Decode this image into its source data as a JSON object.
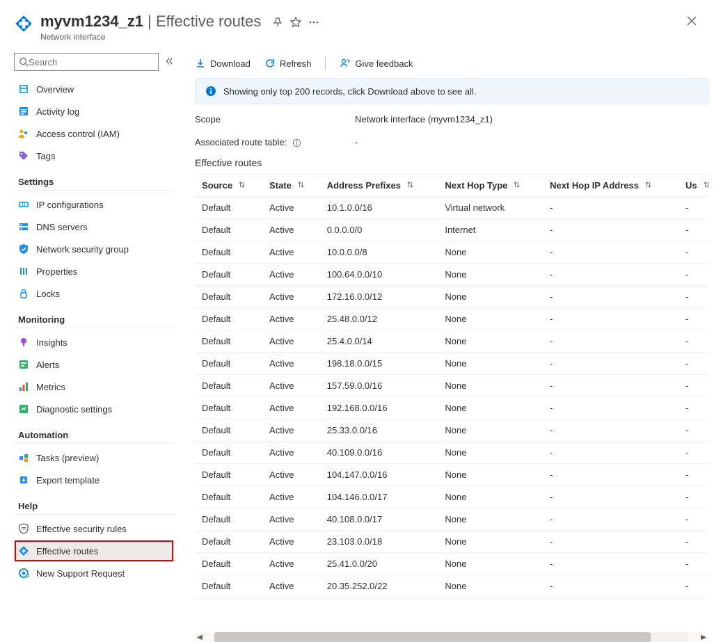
{
  "header": {
    "resource_name": "myvm1234_z1",
    "page_title": "Effective routes",
    "subtitle": "Network interface"
  },
  "search": {
    "placeholder": "Search"
  },
  "sidebar": {
    "top_items": [
      {
        "label": "Overview",
        "icon": "overview",
        "name": "overview"
      },
      {
        "label": "Activity log",
        "icon": "activity",
        "name": "activity-log"
      },
      {
        "label": "Access control (IAM)",
        "icon": "iam",
        "name": "access-control"
      },
      {
        "label": "Tags",
        "icon": "tags",
        "name": "tags"
      }
    ],
    "groups": [
      {
        "title": "Settings",
        "items": [
          {
            "label": "IP configurations",
            "icon": "ipconfig",
            "name": "ip-configurations"
          },
          {
            "label": "DNS servers",
            "icon": "dns",
            "name": "dns-servers"
          },
          {
            "label": "Network security group",
            "icon": "nsg",
            "name": "network-security-group"
          },
          {
            "label": "Properties",
            "icon": "properties",
            "name": "properties"
          },
          {
            "label": "Locks",
            "icon": "locks",
            "name": "locks"
          }
        ]
      },
      {
        "title": "Monitoring",
        "items": [
          {
            "label": "Insights",
            "icon": "insights",
            "name": "insights"
          },
          {
            "label": "Alerts",
            "icon": "alerts",
            "name": "alerts"
          },
          {
            "label": "Metrics",
            "icon": "metrics",
            "name": "metrics"
          },
          {
            "label": "Diagnostic settings",
            "icon": "diag",
            "name": "diagnostic-settings"
          }
        ]
      },
      {
        "title": "Automation",
        "items": [
          {
            "label": "Tasks (preview)",
            "icon": "tasks",
            "name": "tasks"
          },
          {
            "label": "Export template",
            "icon": "export",
            "name": "export-template"
          }
        ]
      },
      {
        "title": "Help",
        "items": [
          {
            "label": "Effective security rules",
            "icon": "effsec",
            "name": "effective-security-rules"
          },
          {
            "label": "Effective routes",
            "icon": "effroutes",
            "name": "effective-routes",
            "selected": true,
            "highlighted": true
          },
          {
            "label": "New Support Request",
            "icon": "support",
            "name": "new-support-request"
          }
        ]
      }
    ]
  },
  "toolbar": {
    "download": "Download",
    "refresh": "Refresh",
    "feedback": "Give feedback"
  },
  "info_bar": "Showing only top 200 records, click Download above to see all.",
  "scope": {
    "label": "Scope",
    "value": "Network interface (myvm1234_z1)"
  },
  "associated": {
    "label": "Associated route table:",
    "value": "-"
  },
  "section_title": "Effective routes",
  "table": {
    "columns": [
      {
        "label": "Source",
        "name": "source"
      },
      {
        "label": "State",
        "name": "state"
      },
      {
        "label": "Address Prefixes",
        "name": "address-prefixes"
      },
      {
        "label": "Next Hop Type",
        "name": "next-hop-type"
      },
      {
        "label": "Next Hop IP Address",
        "name": "next-hop-ip"
      },
      {
        "label": "Us",
        "name": "user-defined-partial"
      }
    ],
    "rows": [
      {
        "source": "Default",
        "state": "Active",
        "prefix": "10.1.0.0/16",
        "nexthop": "Virtual network",
        "ip": "-",
        "us": "-"
      },
      {
        "source": "Default",
        "state": "Active",
        "prefix": "0.0.0.0/0",
        "nexthop": "Internet",
        "ip": "-",
        "us": "-"
      },
      {
        "source": "Default",
        "state": "Active",
        "prefix": "10.0.0.0/8",
        "nexthop": "None",
        "ip": "-",
        "us": "-"
      },
      {
        "source": "Default",
        "state": "Active",
        "prefix": "100.64.0.0/10",
        "nexthop": "None",
        "ip": "-",
        "us": "-"
      },
      {
        "source": "Default",
        "state": "Active",
        "prefix": "172.16.0.0/12",
        "nexthop": "None",
        "ip": "-",
        "us": "-"
      },
      {
        "source": "Default",
        "state": "Active",
        "prefix": "25.48.0.0/12",
        "nexthop": "None",
        "ip": "-",
        "us": "-"
      },
      {
        "source": "Default",
        "state": "Active",
        "prefix": "25.4.0.0/14",
        "nexthop": "None",
        "ip": "-",
        "us": "-"
      },
      {
        "source": "Default",
        "state": "Active",
        "prefix": "198.18.0.0/15",
        "nexthop": "None",
        "ip": "-",
        "us": "-"
      },
      {
        "source": "Default",
        "state": "Active",
        "prefix": "157.59.0.0/16",
        "nexthop": "None",
        "ip": "-",
        "us": "-"
      },
      {
        "source": "Default",
        "state": "Active",
        "prefix": "192.168.0.0/16",
        "nexthop": "None",
        "ip": "-",
        "us": "-"
      },
      {
        "source": "Default",
        "state": "Active",
        "prefix": "25.33.0.0/16",
        "nexthop": "None",
        "ip": "-",
        "us": "-"
      },
      {
        "source": "Default",
        "state": "Active",
        "prefix": "40.109.0.0/16",
        "nexthop": "None",
        "ip": "-",
        "us": "-"
      },
      {
        "source": "Default",
        "state": "Active",
        "prefix": "104.147.0.0/16",
        "nexthop": "None",
        "ip": "-",
        "us": "-"
      },
      {
        "source": "Default",
        "state": "Active",
        "prefix": "104.146.0.0/17",
        "nexthop": "None",
        "ip": "-",
        "us": "-"
      },
      {
        "source": "Default",
        "state": "Active",
        "prefix": "40.108.0.0/17",
        "nexthop": "None",
        "ip": "-",
        "us": "-"
      },
      {
        "source": "Default",
        "state": "Active",
        "prefix": "23.103.0.0/18",
        "nexthop": "None",
        "ip": "-",
        "us": "-"
      },
      {
        "source": "Default",
        "state": "Active",
        "prefix": "25.41.0.0/20",
        "nexthop": "None",
        "ip": "-",
        "us": "-"
      },
      {
        "source": "Default",
        "state": "Active",
        "prefix": "20.35.252.0/22",
        "nexthop": "None",
        "ip": "-",
        "us": "-"
      }
    ]
  }
}
